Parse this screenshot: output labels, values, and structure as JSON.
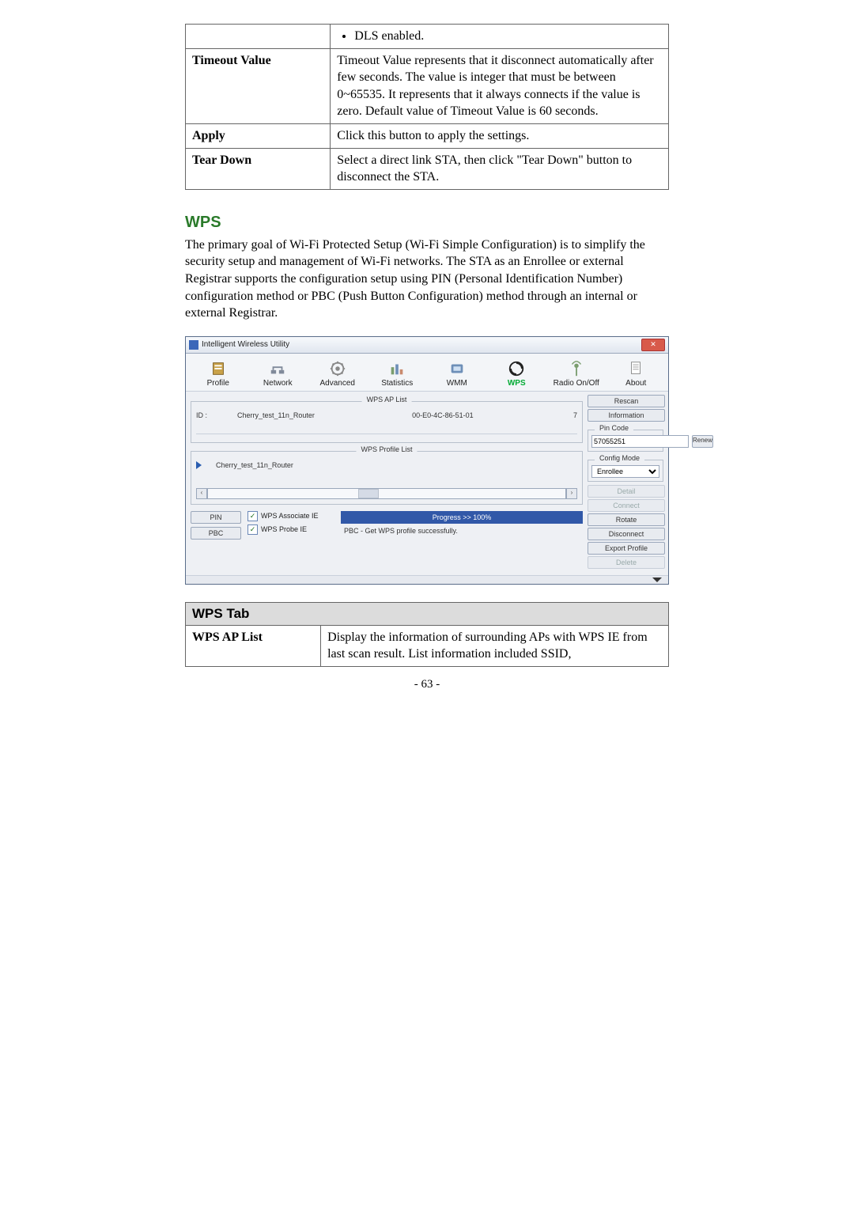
{
  "top_table": {
    "dls_bullet": "DLS enabled.",
    "rows": [
      {
        "label": "Timeout Value",
        "text": "Timeout Value represents that it disconnect automatically after few seconds. The value is integer that must be between 0~65535. It represents that it always connects if the value is zero. Default value of Timeout Value is 60 seconds."
      },
      {
        "label": "Apply",
        "text": "Click this button to apply the settings."
      },
      {
        "label": "Tear Down",
        "text": "Select a direct link STA, then click \"Tear Down\" button to disconnect the STA."
      }
    ]
  },
  "section_heading": "WPS",
  "section_paragraph": "The primary goal of Wi-Fi Protected Setup (Wi-Fi Simple Configuration) is to simplify the security setup and management of Wi-Fi networks. The STA as an Enrollee or external Registrar supports the configuration setup using PIN (Personal Identification Number) configuration method or PBC (Push Button Configuration) method through an internal or external Registrar.",
  "window": {
    "title": "Intelligent Wireless Utility",
    "close_glyph": "✕",
    "toolbar": [
      {
        "name": "profile",
        "label": "Profile"
      },
      {
        "name": "network",
        "label": "Network"
      },
      {
        "name": "advanced",
        "label": "Advanced"
      },
      {
        "name": "statistics",
        "label": "Statistics"
      },
      {
        "name": "wmm",
        "label": "WMM"
      },
      {
        "name": "wps",
        "label": "WPS"
      },
      {
        "name": "radio",
        "label": "Radio On/Off"
      },
      {
        "name": "about",
        "label": "About"
      }
    ],
    "aplist": {
      "title": "WPS AP List",
      "id_label": "ID :",
      "ssid": "Cherry_test_11n_Router",
      "mac": "00-E0-4C-86-51-01",
      "channel": "7"
    },
    "profile_list": {
      "title": "WPS Profile List",
      "entry": "Cherry_test_11n_Router"
    },
    "pin_btn": "PIN",
    "pbc_btn": "PBC",
    "chk_assoc": "WPS Associate IE",
    "chk_probe": "WPS Probe IE",
    "progress_label": "Progress >> 100%",
    "status_text": "PBC - Get WPS profile successfully.",
    "right": {
      "rescan": "Rescan",
      "information": "Information",
      "pincode_title": "Pin Code",
      "pincode_value": "57055251",
      "renew": "Renew",
      "config_title": "Config Mode",
      "config_value": "Enrollee",
      "detail": "Detail",
      "connect": "Connect",
      "rotate": "Rotate",
      "disconnect": "Disconnect",
      "export": "Export Profile",
      "delete": "Delete"
    }
  },
  "wps_desc": {
    "header": "WPS Tab",
    "row_label": "WPS AP List",
    "row_text": "Display the information of surrounding APs with WPS IE from last scan result. List information included SSID,"
  },
  "page_number": "- 63 -"
}
